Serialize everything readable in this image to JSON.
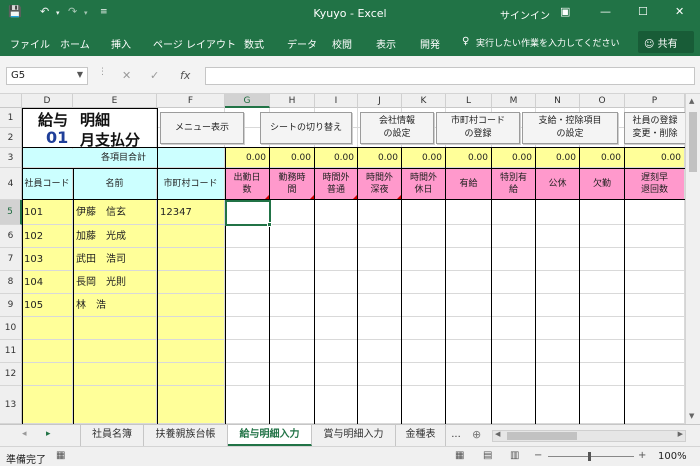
{
  "window": {
    "title": "Kyuyo - Excel",
    "signin": "サインイン",
    "share": "共有"
  },
  "ribbon_tabs": [
    "ファイル",
    "ホーム",
    "挿入",
    "ページ レイアウト",
    "数式",
    "データ",
    "校閲",
    "表示",
    "開発"
  ],
  "tell_me": "実行したい作業を入力してください",
  "formula_bar": {
    "name_box": "G5",
    "formula": ""
  },
  "columns": [
    "D",
    "E",
    "F",
    "G",
    "H",
    "I",
    "J",
    "K",
    "L",
    "M",
    "N",
    "O",
    "P"
  ],
  "rows": [
    "1",
    "2",
    "3",
    "4",
    "5",
    "6",
    "7",
    "8",
    "9",
    "10",
    "11",
    "12",
    "13"
  ],
  "sheet": {
    "title_prefix": "給与",
    "title_suffix": "明細",
    "month_number": "01",
    "month_label": "月支払分",
    "buttons": [
      "メニュー表示",
      "シートの切り替え",
      "会社情報\nの設定",
      "市町村コード\nの登録",
      "支給・控除項目\nの設定",
      "社員の登録\n変更・削除"
    ],
    "totals_label": "各項目合計",
    "totals": [
      "0.00",
      "0.00",
      "0.00",
      "0.00",
      "0.00",
      "0.00",
      "0.00",
      "0.00",
      "0.00",
      "0.00"
    ],
    "headers": [
      "社員コード",
      "名前",
      "市町村コード"
    ],
    "item_headers": [
      "出勤日\n数",
      "勤務時\n間",
      "時間外\n普通",
      "時間外\n深夜",
      "時間外\n休日",
      "有給",
      "特別有\n給",
      "公休",
      "欠勤",
      "遅刻早\n退回数",
      "遅"
    ],
    "employees": [
      {
        "code": "101",
        "name": "伊藤　信玄",
        "city": "12347"
      },
      {
        "code": "102",
        "name": "加藤　光成",
        "city": ""
      },
      {
        "code": "103",
        "name": "武田　浩司",
        "city": ""
      },
      {
        "code": "104",
        "name": "長岡　光則",
        "city": ""
      },
      {
        "code": "105",
        "name": "林　浩",
        "city": ""
      }
    ]
  },
  "sheet_tabs": [
    "社員名簿",
    "扶養親族台帳",
    "給与明細入力",
    "賞与明細入力",
    "金種表",
    "..."
  ],
  "active_tab": "給与明細入力",
  "status": {
    "mode": "準備完了",
    "zoom": "100%"
  },
  "colors": {
    "accent": "#217346",
    "yellow": "#ffff99",
    "cyan": "#ccffff",
    "pink": "#ff99cc"
  }
}
